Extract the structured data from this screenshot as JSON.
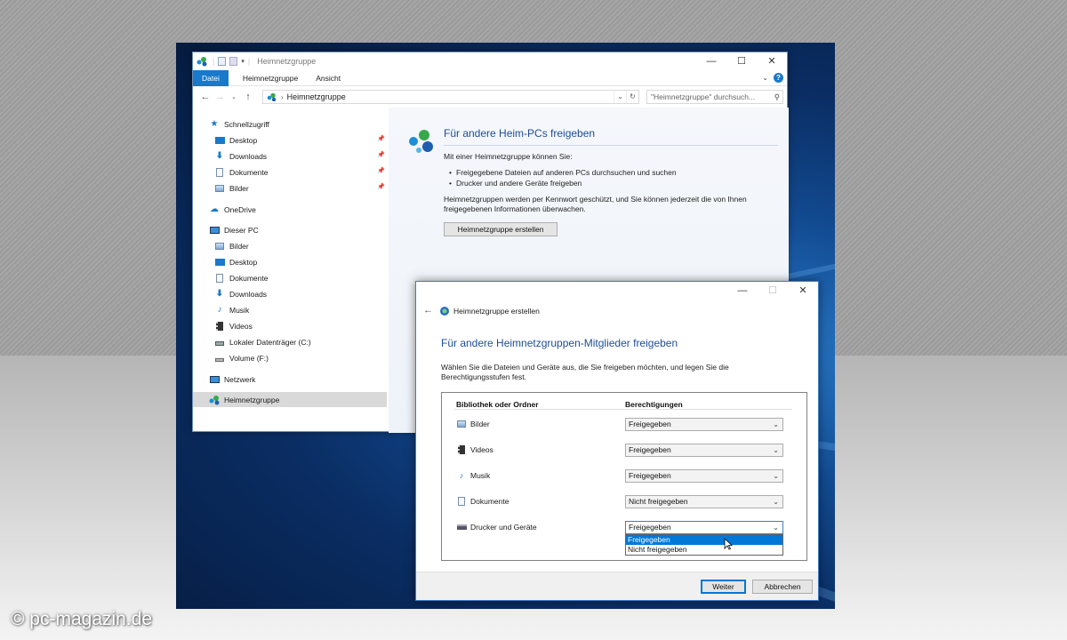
{
  "explorer": {
    "title": "Heimnetzgruppe",
    "ribbon_tabs": [
      "Datei",
      "Heimnetzgruppe",
      "Ansicht"
    ],
    "window_controls": {
      "minimize": "—",
      "maximize": "☐",
      "close": "✕"
    },
    "address": "Heimnetzgruppe",
    "search_placeholder": "\"Heimnetzgruppe\" durchsuch...",
    "nav": {
      "quick_access": "Schnellzugriff",
      "quick_items": [
        "Desktop",
        "Downloads",
        "Dokumente",
        "Bilder"
      ],
      "onedrive": "OneDrive",
      "this_pc": "Dieser PC",
      "pc_items": [
        "Bilder",
        "Desktop",
        "Dokumente",
        "Downloads",
        "Musik",
        "Videos",
        "Lokaler Datenträger (C:)",
        "Volume (F:)"
      ],
      "network": "Netzwerk",
      "homegroup": "Heimnetzgruppe"
    },
    "content": {
      "title": "Für andere Heim-PCs freigeben",
      "intro": "Mit einer Heimnetzgruppe können Sie:",
      "bullets": [
        "Freigegebene Dateien auf anderen PCs durchsuchen und suchen",
        "Drucker und andere Geräte freigeben"
      ],
      "note_line1": "Heimnetzgruppen werden per Kennwort geschützt, und Sie können jederzeit die von Ihnen",
      "note_line2": "freigegebenen Informationen überwachen.",
      "create_button": "Heimnetzgruppe erstellen"
    }
  },
  "wizard": {
    "header": "Heimnetzgruppe erstellen",
    "title": "Für andere Heimnetzgruppen-Mitglieder freigeben",
    "description": "Wählen Sie die Dateien und Geräte aus, die Sie freigeben möchten, und legen Sie die Berechtigungsstufen fest.",
    "col_library": "Bibliothek oder Ordner",
    "col_permissions": "Berechtigungen",
    "rows": [
      {
        "label": "Bilder",
        "value": "Freigegeben"
      },
      {
        "label": "Videos",
        "value": "Freigegeben"
      },
      {
        "label": "Musik",
        "value": "Freigegeben"
      },
      {
        "label": "Dokumente",
        "value": "Nicht freigegeben"
      },
      {
        "label": "Drucker und Geräte",
        "value": "Freigegeben"
      }
    ],
    "dropdown_options": [
      "Freigegeben",
      "Nicht freigegeben"
    ],
    "next_button": "Weiter",
    "cancel_button": "Abbrechen"
  },
  "watermark": "© pc-magazin.de",
  "colors": {
    "accent": "#1979ca",
    "title_blue": "#1e4e94",
    "selection": "#0078d7"
  }
}
